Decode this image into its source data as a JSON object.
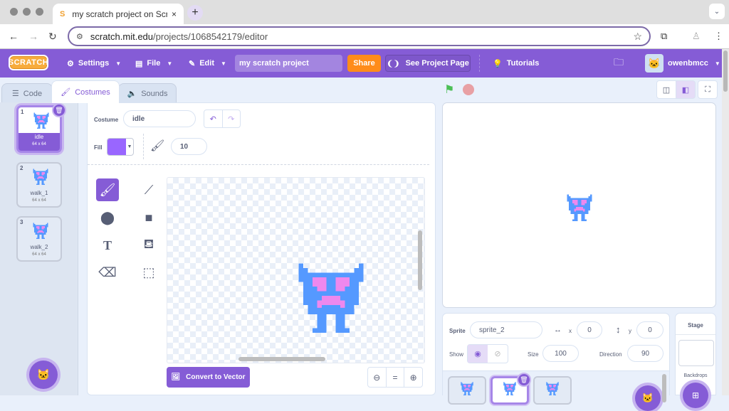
{
  "browser": {
    "tab_title": "my scratch project on Scratch",
    "tab_favicon": "scratch-cat-icon",
    "url_host": "scratch.mit.edu",
    "url_path": "/projects/1068542179/editor",
    "close_glyph": "×",
    "newtab_glyph": "+",
    "back_glyph": "←",
    "forward_glyph": "→",
    "reload_glyph": "↻",
    "star_glyph": "☆",
    "menu_glyph": "⋮"
  },
  "menubar": {
    "logo": "SCRATCH",
    "settings": "Settings",
    "file": "File",
    "edit": "Edit",
    "project_title": "my scratch project",
    "share": "Share",
    "see_project_page": "See Project Page",
    "tutorials": "Tutorials",
    "username": "owenbmcc",
    "accent": "#855cd6",
    "share_color": "#ff8c1a"
  },
  "editor_tabs": [
    {
      "label": "Code",
      "active": false
    },
    {
      "label": "Costumes",
      "active": true
    },
    {
      "label": "Sounds",
      "active": false
    }
  ],
  "costumes": [
    {
      "num": "1",
      "name": "idle",
      "size": "64 x 64",
      "selected": true
    },
    {
      "num": "2",
      "name": "walk_1",
      "size": "64 x 64",
      "selected": false
    },
    {
      "num": "3",
      "name": "walk_2",
      "size": "64 x 64",
      "selected": false
    }
  ],
  "paint": {
    "costume_label": "Costume",
    "costume_name": "idle",
    "fill_label": "Fill",
    "fill_color": "#9966ff",
    "brush_size": "10",
    "convert_label": "Convert to Vector",
    "zoom_out": "−",
    "zoom_reset": "=",
    "zoom_in": "+"
  },
  "sprite_info": {
    "sprite_label": "Sprite",
    "sprite_name": "sprite_2",
    "x_label": "x",
    "x_value": "0",
    "y_label": "y",
    "y_value": "0",
    "show_label": "Show",
    "size_label": "Size",
    "size_value": "100",
    "direction_label": "Direction",
    "direction_value": "90"
  },
  "stage_pane": {
    "title": "Stage",
    "backdrops_label": "Backdrops"
  },
  "sprite_colors": {
    "body": "#5599ff",
    "face": "#ee88ee"
  }
}
